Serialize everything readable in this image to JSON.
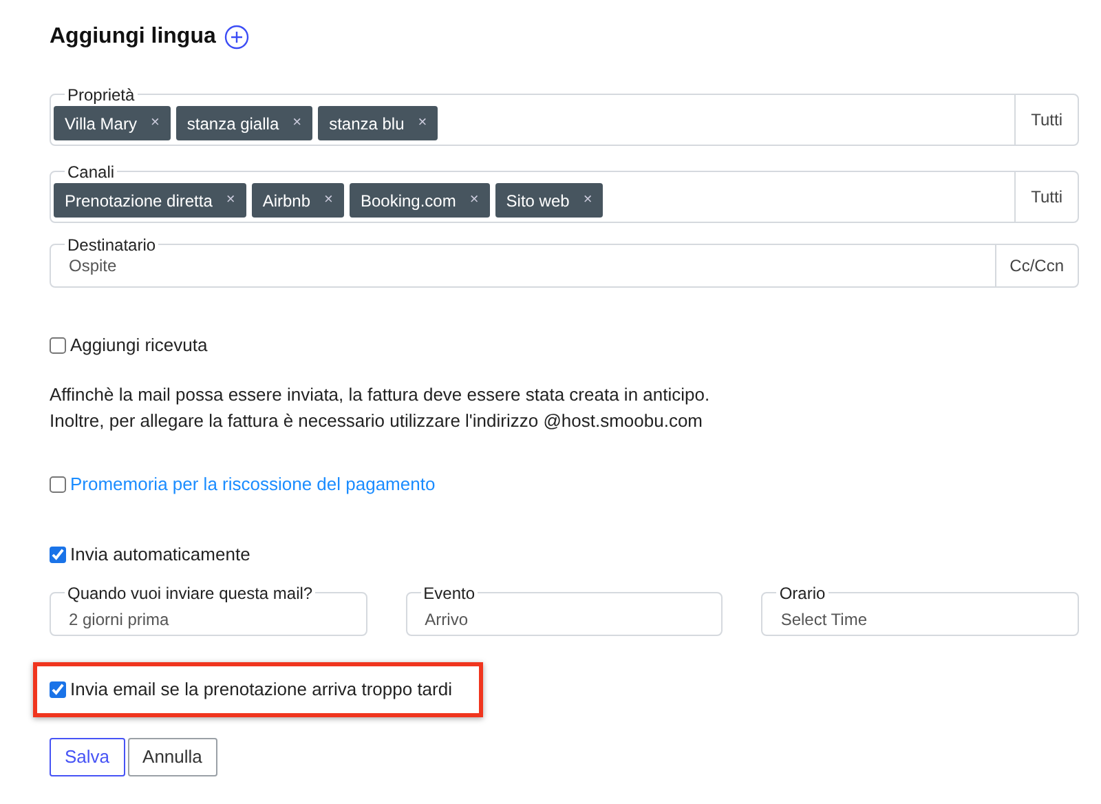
{
  "heading": {
    "title": "Aggiungi lingua"
  },
  "tag_fields": [
    {
      "label": "Proprietà",
      "tags": [
        "Villa Mary",
        "stanza gialla",
        "stanza blu"
      ],
      "remove": "×",
      "addon": "Tutti"
    },
    {
      "label": "Canali",
      "tags": [
        "Prenotazione diretta",
        "Airbnb",
        "Booking.com",
        "Sito web"
      ],
      "remove": "×",
      "addon": "Tutti"
    }
  ],
  "recipient": {
    "label": "Destinatario",
    "value": "Ospite",
    "addon": "Cc/Ccn"
  },
  "receipt": {
    "label": "Aggiungi ricevuta",
    "checked": false,
    "highlighted": false
  },
  "note": [
    "Affinchè la mail possa essere inviata, la fattura deve essere stata creata in anticipo.",
    "Inoltre, per allegare la fattura è necessario utilizzare l'indirizzo @host.smoobu.com"
  ],
  "reminder": {
    "label": "Promemoria per la riscossione del pagamento",
    "checked": false,
    "highlighted": false
  },
  "auto_send": {
    "label": "Invia automaticamente",
    "checked": true,
    "highlighted": false
  },
  "schedule": [
    {
      "label": "Quando vuoi inviare questa mail?",
      "value": "2 giorni prima"
    },
    {
      "label": "Evento",
      "value": "Arrivo"
    },
    {
      "label": "Orario",
      "placeholder": "Select Time"
    }
  ],
  "late_booking": {
    "label": "Invia email se la prenotazione arriva troppo tardi",
    "checked": true,
    "highlighted": true
  },
  "buttons": [
    {
      "label": "Salva",
      "kind": "primary"
    },
    {
      "label": "Annulla",
      "kind": "secondary"
    }
  ]
}
